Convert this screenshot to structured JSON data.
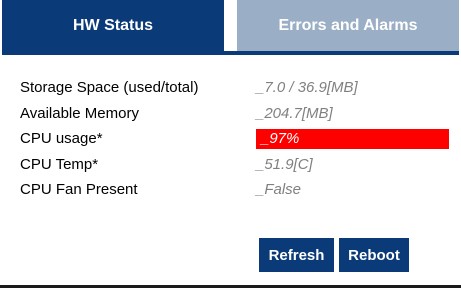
{
  "tabs": [
    {
      "label": "HW Status",
      "active": true
    },
    {
      "label": "Errors and Alarms",
      "active": false
    }
  ],
  "status_rows": [
    {
      "label": "Storage Space (used/total)",
      "value": "_7.0 / 36.9[MB]",
      "alert": false
    },
    {
      "label": "Available Memory",
      "value": "_204.7[MB]",
      "alert": false
    },
    {
      "label": "CPU usage*",
      "value": "_97%",
      "alert": true
    },
    {
      "label": "CPU Temp*",
      "value": "_51.9[C]",
      "alert": false
    },
    {
      "label": "CPU Fan Present",
      "value": "_False",
      "alert": false
    }
  ],
  "actions": {
    "refresh_label": "Refresh",
    "reboot_label": "Reboot"
  },
  "colors": {
    "accent": "#0a3a78",
    "inactive_tab": "#9aaec6",
    "alert": "#ff0000",
    "value_text": "#808080"
  }
}
